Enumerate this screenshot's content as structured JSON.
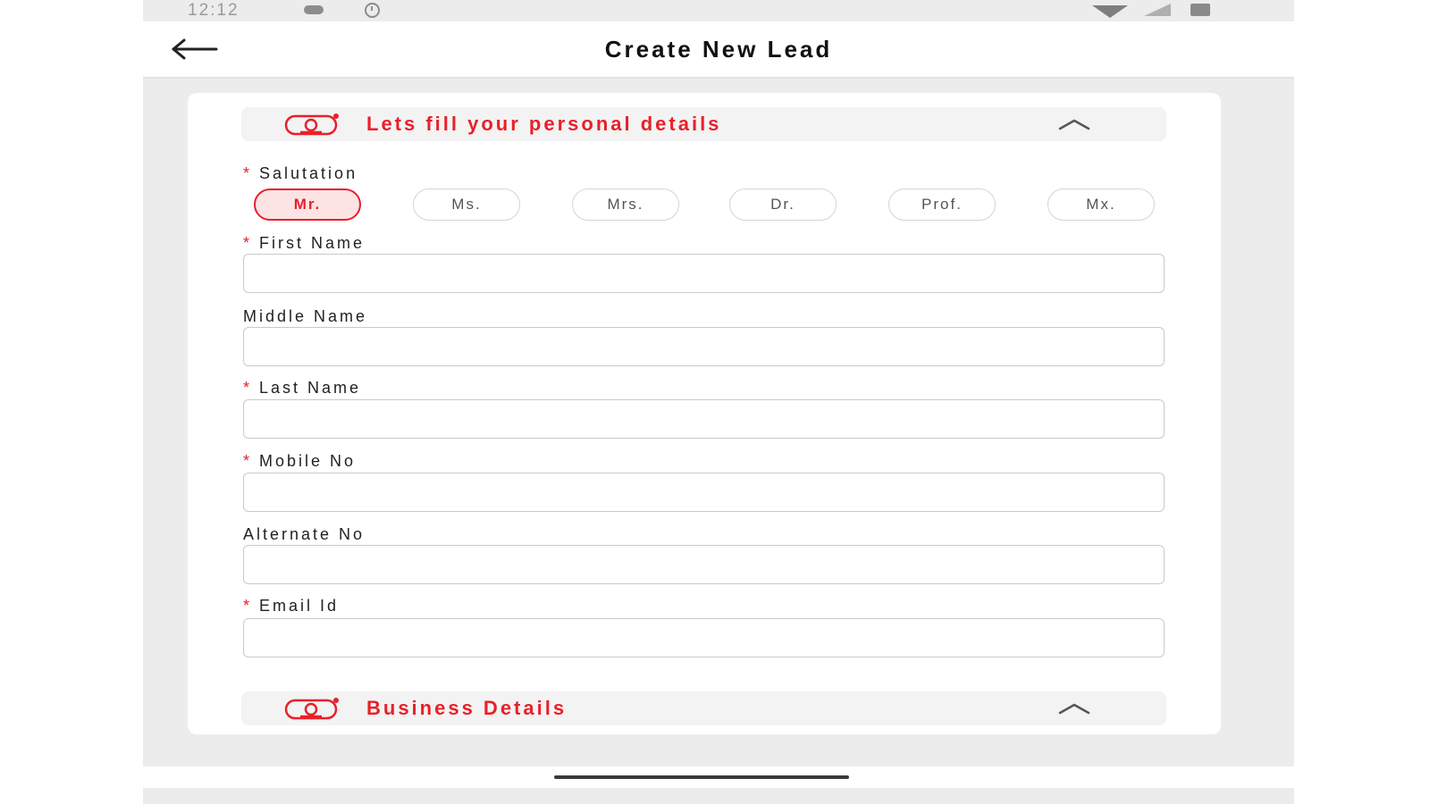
{
  "status_bar": {
    "time": "12:12"
  },
  "app_bar": {
    "title": "Create New Lead"
  },
  "personal_section": {
    "title": "Lets fill your personal details",
    "salutation": {
      "label": "Salutation",
      "options": [
        "Mr.",
        "Ms.",
        "Mrs.",
        "Dr.",
        "Prof.",
        "Mx."
      ],
      "selected": "Mr."
    },
    "fields": {
      "first_name": {
        "label": "First Name",
        "required": true,
        "value": ""
      },
      "middle_name": {
        "label": "Middle Name",
        "required": false,
        "value": ""
      },
      "last_name": {
        "label": "Last Name",
        "required": true,
        "value": ""
      },
      "mobile_no": {
        "label": "Mobile No",
        "required": true,
        "value": ""
      },
      "alternate_no": {
        "label": "Alternate No",
        "required": false,
        "value": ""
      },
      "email_id": {
        "label": "Email Id",
        "required": true,
        "value": ""
      }
    }
  },
  "business_section": {
    "title": "Business Details"
  },
  "required_marker": "*",
  "icons": {
    "back": "arrow-left-icon",
    "personal_section": "person-badge-icon",
    "business_section": "person-badge-icon",
    "collapse": "chevron-up-icon"
  },
  "colors": {
    "accent": "#e8202a",
    "selected_chip_bg": "#fce3e4",
    "background": "#ececec",
    "card": "#ffffff"
  }
}
